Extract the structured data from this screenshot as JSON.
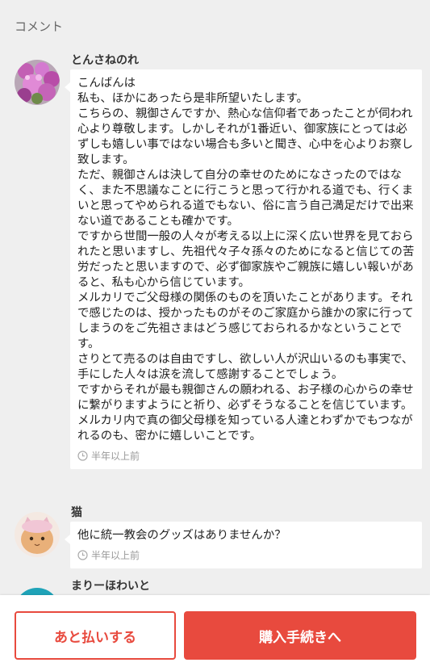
{
  "section_title": "コメント",
  "comments": [
    {
      "username": "とんさねのれ",
      "text": "こんばんは\n私も、ほかにあったら是非所望いたします。\nこちらの、親御さんですか、熱心な信仰者であったことが伺われ心より尊敬します。しかしそれが1番近い、御家族にとっては必ずしも嬉しい事ではない場合も多いと聞き、心中を心よりお察し致します。\nただ、親御さんは決して自分の幸せのためになさったのではなく、また不思議なことに行こうと思って行かれる道でも、行くまいと思ってやめられる道でもない、俗に言う自己満足だけで出来ない道であることも確かです。\nですから世間一般の人々が考える以上に深く広い世界を見ておられたと思いますし、先祖代々子々孫々のためになると信じての苦労だったと思いますので、必ず御家族やご親族に嬉しい報いがあると、私も心から信じています。\nメルカリでご父母様の関係のものを頂いたことがあります。それで感じたのは、授かったものがそのご家庭から誰かの家に行ってしまうのをご先祖さまはどう感じておられるかなということです。\nさりとて売るのは自由ですし、欲しい人が沢山いるのも事実で、手にした人々は涙を流して感謝することでしょう。\nですからそれが最も親御さんの願われる、お子様の心からの幸せに繋がりますようにと祈り、必ずそうなることを信じています。\nメルカリ内で真の御父母様を知っている人達とわずかでもつながれるのも、密かに嬉しいことです。",
      "time": "半年以上前",
      "avatar_icon": "flower-avatar-icon"
    },
    {
      "username": "猫",
      "text": "他に統一教会のグッズはありませんか？",
      "time": "半年以上前",
      "avatar_icon": "cat-avatar-icon"
    },
    {
      "username": "まりーほわいと",
      "avatar_icon": "teal-avatar-icon"
    }
  ],
  "footer": {
    "pay_later_label": "あと払いする",
    "purchase_label": "購入手続きへ"
  },
  "colors": {
    "accent": "#e84a3e",
    "background": "#efefef"
  }
}
